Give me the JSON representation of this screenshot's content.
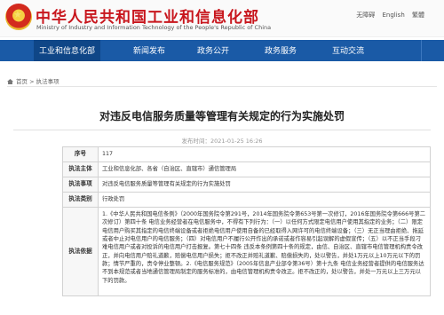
{
  "header": {
    "site_title": "中华人民共和国工业和信息化部",
    "site_subtitle": "Ministry of Industry and Information Technology of the People's Republic of China",
    "top_links": [
      "无障碍",
      "English",
      "繁體"
    ]
  },
  "nav": {
    "items": [
      "工业和信息化部",
      "新闻发布",
      "政务公开",
      "政务服务",
      "互动交流"
    ],
    "active_index": 0
  },
  "breadcrumb": [
    "首页",
    "执法事项"
  ],
  "article": {
    "title": "对违反电信服务质量等管理有关规定的行为实施处罚",
    "publish_time": "发布时间：2021-01-25 16:26"
  },
  "table": {
    "rows": [
      {
        "label": "序号",
        "value": "117"
      },
      {
        "label": "执法主体",
        "value": "工业和信息化部、各省（自治区、直辖市）通信管理局"
      },
      {
        "label": "执法事项",
        "value": "对违反电信服务质量等管理有关规定的行为实施处罚"
      },
      {
        "label": "执法类别",
        "value": "行政处罚"
      },
      {
        "label": "执法依据",
        "value": "1.《中华人民共和国电信条例》（2000年国务院令第291号，2014年国务院令第653号第一次修订，2016年国务院令第666号第二次修订）第四十条 电信业务经营者在电信服务中，不得有下列行为：（一）以任何方式限定电信用户使用其指定的业务；（二）限定电信用户购买其指定的电信终端设备或者拒绝电信用户使用自备的已经取得入网许可的电信终端设备；（三）无正当理由拒绝、拖延或者中止对电信用户的电信服务；（四）对电信用户不履行公开作出的承诺或者作容易引起误解的虚假宣传；（五）以不正当手段刁难电信用户或者对投诉的电信用户打击报复。第七十四条 违反本条例第四十条的规定，由信、自治区、直辖市电信管理机构责令改正，并向电信用户赔礼道歉，赔偿电信用户损失；拒不改正并赔礼道歉、赔偿损失的，处以警告，并处1万元以上10万元以下的罚款；情节严重的，责令停业整顿。2.《电信服务规范》（2005年信息产业部令第36号）第十九条 电信业务经营者提供的电信服务达不到本规范或者当地通信管理局制定的服务标准的，由电信管理机构责令改正。拒不改正的，处以警告，并处一万元以上三万元以下的罚款。"
      }
    ]
  }
}
